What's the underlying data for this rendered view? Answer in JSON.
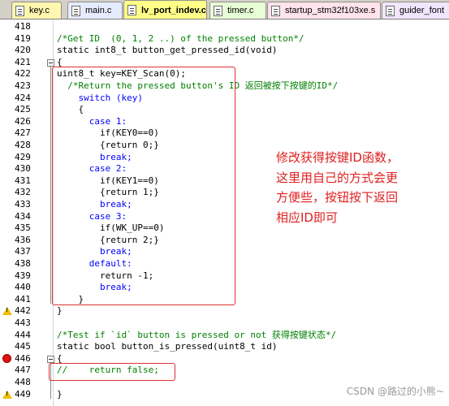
{
  "tabs": [
    {
      "label": "key.c",
      "active": false,
      "color": "#fff6b0"
    },
    {
      "label": "main.c",
      "active": false,
      "color": "#e6ecff"
    },
    {
      "label": "lv_port_indev.c",
      "active": true,
      "color": "#ffff88"
    },
    {
      "label": "timer.c",
      "active": false,
      "color": "#e8ffd6"
    },
    {
      "label": "startup_stm32f103xe.s",
      "active": false,
      "color": "#ffe4ec"
    },
    {
      "label": "guider_font",
      "active": false,
      "color": "#f2e6ff"
    }
  ],
  "code_lines": [
    {
      "num": "418",
      "text": ""
    },
    {
      "num": "419",
      "text": "/*Get ID  (0, 1, 2 ..) of the pressed button*/"
    },
    {
      "num": "420",
      "text": "static int8_t button_get_pressed_id(void)"
    },
    {
      "num": "421",
      "text": "{"
    },
    {
      "num": "422",
      "text": "uint8_t key=KEY_Scan(0);"
    },
    {
      "num": "423",
      "text": "  /*Return the pressed button's ID 返回被按下按键的ID*/"
    },
    {
      "num": "424",
      "text": "    switch (key)"
    },
    {
      "num": "425",
      "text": "    {"
    },
    {
      "num": "426",
      "text": "      case 1:"
    },
    {
      "num": "427",
      "text": "        if(KEY0==0)"
    },
    {
      "num": "428",
      "text": "        {return 0;}"
    },
    {
      "num": "429",
      "text": "        break;"
    },
    {
      "num": "430",
      "text": "      case 2:"
    },
    {
      "num": "431",
      "text": "        if(KEY1==0)"
    },
    {
      "num": "432",
      "text": "        {return 1;}"
    },
    {
      "num": "433",
      "text": "        break;"
    },
    {
      "num": "434",
      "text": "      case 3:"
    },
    {
      "num": "435",
      "text": "        if(WK_UP==0)"
    },
    {
      "num": "436",
      "text": "        {return 2;}"
    },
    {
      "num": "437",
      "text": "        break;"
    },
    {
      "num": "438",
      "text": "      default:"
    },
    {
      "num": "439",
      "text": "        return -1;"
    },
    {
      "num": "440",
      "text": "        break;"
    },
    {
      "num": "441",
      "text": "    }"
    },
    {
      "num": "442",
      "text": "}"
    },
    {
      "num": "443",
      "text": ""
    },
    {
      "num": "444",
      "text": "/*Test if `id` button is pressed or not 获得按键状态*/"
    },
    {
      "num": "445",
      "text": "static bool button_is_pressed(uint8_t id)"
    },
    {
      "num": "446",
      "text": "{"
    },
    {
      "num": "447",
      "text": "//    return false;"
    },
    {
      "num": "448",
      "text": ""
    },
    {
      "num": "449",
      "text": "}"
    }
  ],
  "annotation": {
    "lines": [
      "修改获得按键ID函数，",
      "这里用自己的方式会更",
      "方便些，按钮按下返回",
      "相应ID即可"
    ],
    "color": "#e02020"
  },
  "watermark": "CSDN @路过的小熊~",
  "markers": {
    "warning_lines": [
      "442",
      "449"
    ],
    "breakpoint_lines": [
      "446"
    ]
  }
}
